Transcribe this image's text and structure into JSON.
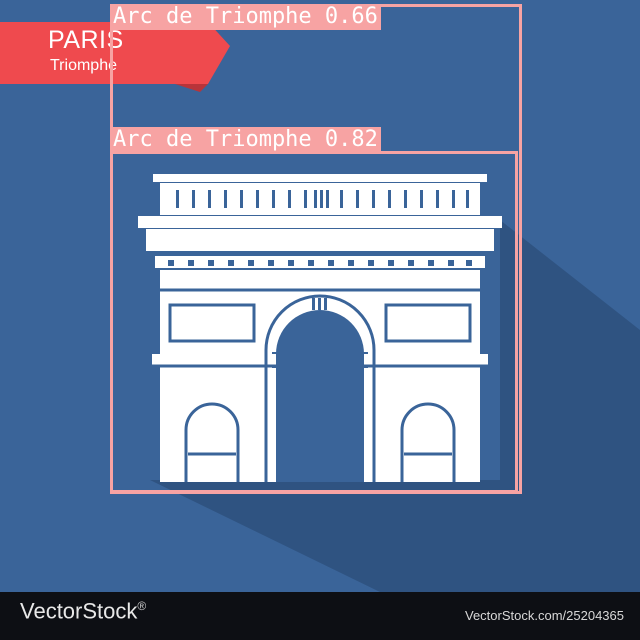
{
  "ribbon": {
    "title": "PARIS",
    "subtitle": "Triomphe"
  },
  "detections": [
    {
      "label": "Arc de Triomphe 0.66"
    },
    {
      "label": "Arc de Triomphe 0.82"
    }
  ],
  "footer": {
    "brand": "VectorStock",
    "brand_mark": "®",
    "url": "VectorStock.com/25204365"
  },
  "colors": {
    "background": "#3a6499",
    "shadow": "#2f5381",
    "ribbon": "#ef4a4e",
    "monument": "#ffffff",
    "detection_box": "#f7a3a3",
    "footer": "#0d0f14"
  },
  "icons": {
    "brand_mark": "vectorstock-logo-icon"
  }
}
